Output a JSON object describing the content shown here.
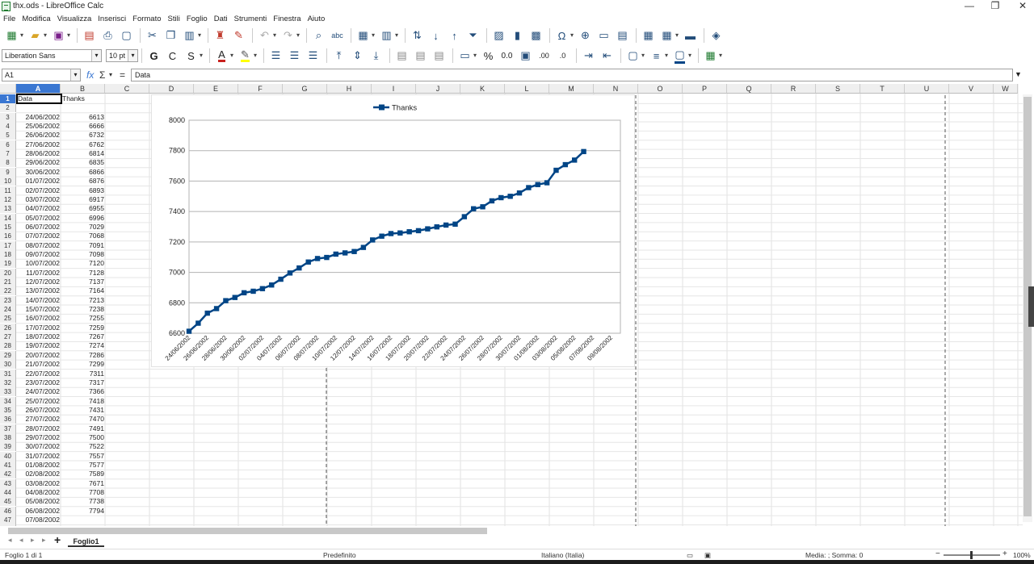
{
  "window": {
    "title": "thx.ods - LibreOffice Calc"
  },
  "menu": [
    "File",
    "Modifica",
    "Visualizza",
    "Inserisci",
    "Formato",
    "Stili",
    "Foglio",
    "Dati",
    "Strumenti",
    "Finestra",
    "Aiuto"
  ],
  "toolbar2": {
    "font_name": "Liberation Sans",
    "font_size": "10 pt",
    "bold_label": "G",
    "italic_label": "C",
    "underline_label": "S",
    "font_color_label": "A",
    "percent_label": "%",
    "number_label": "0.0",
    "decimal_add_label": ".00",
    "decimal_remove_label": ".0"
  },
  "formula_bar": {
    "name_box": "A1",
    "content": "Data"
  },
  "columns": [
    "A",
    "B",
    "C",
    "D",
    "E",
    "F",
    "G",
    "H",
    "I",
    "J",
    "K",
    "L",
    "M",
    "N",
    "O",
    "P",
    "Q",
    "R",
    "S",
    "T",
    "U",
    "V",
    "W"
  ],
  "sheet": {
    "header_a": "Data",
    "header_b": "Thanks",
    "rows": [
      [
        "24/06/2002",
        "6613"
      ],
      [
        "25/06/2002",
        "6666"
      ],
      [
        "26/06/2002",
        "6732"
      ],
      [
        "27/06/2002",
        "6762"
      ],
      [
        "28/06/2002",
        "6814"
      ],
      [
        "29/06/2002",
        "6835"
      ],
      [
        "30/06/2002",
        "6866"
      ],
      [
        "01/07/2002",
        "6876"
      ],
      [
        "02/07/2002",
        "6893"
      ],
      [
        "03/07/2002",
        "6917"
      ],
      [
        "04/07/2002",
        "6955"
      ],
      [
        "05/07/2002",
        "6996"
      ],
      [
        "06/07/2002",
        "7029"
      ],
      [
        "07/07/2002",
        "7068"
      ],
      [
        "08/07/2002",
        "7091"
      ],
      [
        "09/07/2002",
        "7098"
      ],
      [
        "10/07/2002",
        "7120"
      ],
      [
        "11/07/2002",
        "7128"
      ],
      [
        "12/07/2002",
        "7137"
      ],
      [
        "13/07/2002",
        "7164"
      ],
      [
        "14/07/2002",
        "7213"
      ],
      [
        "15/07/2002",
        "7238"
      ],
      [
        "16/07/2002",
        "7255"
      ],
      [
        "17/07/2002",
        "7259"
      ],
      [
        "18/07/2002",
        "7267"
      ],
      [
        "19/07/2002",
        "7274"
      ],
      [
        "20/07/2002",
        "7286"
      ],
      [
        "21/07/2002",
        "7299"
      ],
      [
        "22/07/2002",
        "7311"
      ],
      [
        "23/07/2002",
        "7317"
      ],
      [
        "24/07/2002",
        "7366"
      ],
      [
        "25/07/2002",
        "7418"
      ],
      [
        "26/07/2002",
        "7431"
      ],
      [
        "27/07/2002",
        "7470"
      ],
      [
        "28/07/2002",
        "7491"
      ],
      [
        "29/07/2002",
        "7500"
      ],
      [
        "30/07/2002",
        "7522"
      ],
      [
        "31/07/2002",
        "7557"
      ],
      [
        "01/08/2002",
        "7577"
      ],
      [
        "02/08/2002",
        "7589"
      ],
      [
        "03/08/2002",
        "7671"
      ],
      [
        "04/08/2002",
        "7708"
      ],
      [
        "05/08/2002",
        "7738"
      ],
      [
        "06/08/2002",
        "7794"
      ],
      [
        "07/08/2002",
        ""
      ]
    ]
  },
  "chart_data": {
    "type": "line",
    "series": [
      {
        "name": "Thanks",
        "color": "#004586",
        "values": [
          6613,
          6666,
          6732,
          6762,
          6814,
          6835,
          6866,
          6876,
          6893,
          6917,
          6955,
          6996,
          7029,
          7068,
          7091,
          7098,
          7120,
          7128,
          7137,
          7164,
          7213,
          7238,
          7255,
          7259,
          7267,
          7274,
          7286,
          7299,
          7311,
          7317,
          7366,
          7418,
          7431,
          7470,
          7491,
          7500,
          7522,
          7557,
          7577,
          7589,
          7671,
          7708,
          7738,
          7794
        ]
      }
    ],
    "x_tick_labels": [
      "24/06/2002",
      "26/06/2002",
      "28/06/2002",
      "30/06/2002",
      "02/07/2002",
      "04/07/2002",
      "06/07/2002",
      "08/07/2002",
      "10/07/2002",
      "12/07/2002",
      "14/07/2002",
      "16/07/2002",
      "18/07/2002",
      "20/07/2002",
      "22/07/2002",
      "24/07/2002",
      "26/07/2002",
      "28/07/2002",
      "30/07/2002",
      "01/08/2002",
      "03/08/2002",
      "05/08/2002",
      "07/08/2002",
      "09/08/2002"
    ],
    "y_ticks": [
      6600,
      6800,
      7000,
      7200,
      7400,
      7600,
      7800,
      8000
    ],
    "ylim": [
      6600,
      8000
    ],
    "legend_position": "top",
    "grid": true
  },
  "sheet_tab": "Foglio1",
  "status": {
    "sheet_info": "Foglio 1 di 1",
    "page_style": "Predefinito",
    "language": "Italiano (Italia)",
    "summary": "Media: ; Somma: 0",
    "zoom": "100%"
  }
}
